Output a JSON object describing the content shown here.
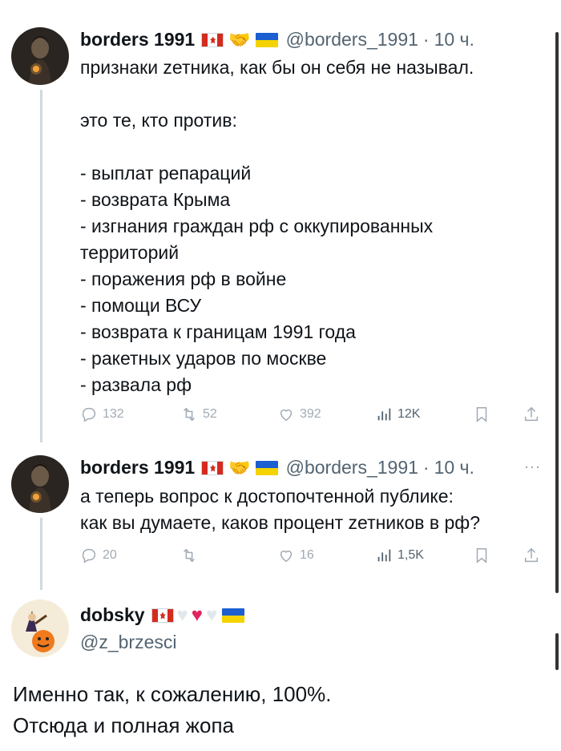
{
  "tweets": [
    {
      "author": "borders 1991",
      "handle": "@borders_1991",
      "separator": "·",
      "time": "10 ч.",
      "text": "признаки zетника, как бы он себя не называл.\n\nэто те, кто против:\n\n- выплат репараций\n- возврата Крыма\n- изгнания граждан рф с оккупированных\nтерриторий\n- поражения рф в войне\n- помощи ВСУ\n- возврата к границам 1991 года\n- ракетных ударов по москве\n- развала рф",
      "stats": {
        "replies": "132",
        "reposts": "52",
        "likes": "392",
        "views": "12K"
      }
    },
    {
      "author": "borders 1991",
      "handle": "@borders_1991",
      "separator": "·",
      "time": "10 ч.",
      "more": "···",
      "text": "а теперь вопрос к достопочтенной публике:\nкак вы думаете, каков процент zетников в рф?",
      "stats": {
        "replies": "20",
        "reposts": "",
        "likes": "16",
        "views": "1,5K"
      }
    }
  ],
  "reply": {
    "author": "dobsky",
    "handle": "@z_brzesci",
    "text": "Именно так, к сожалению, 100%.\nОтсюда и полная жопа"
  },
  "icons": {
    "reply": "reply-icon",
    "repost": "repost-icon",
    "like": "heart-icon",
    "views": "views-icon",
    "bookmark": "bookmark-icon",
    "share": "share-icon"
  },
  "colors": {
    "text": "#0f1419",
    "secondary": "#536471",
    "action": "#a0aab4",
    "thread_line": "#cfd9de"
  }
}
